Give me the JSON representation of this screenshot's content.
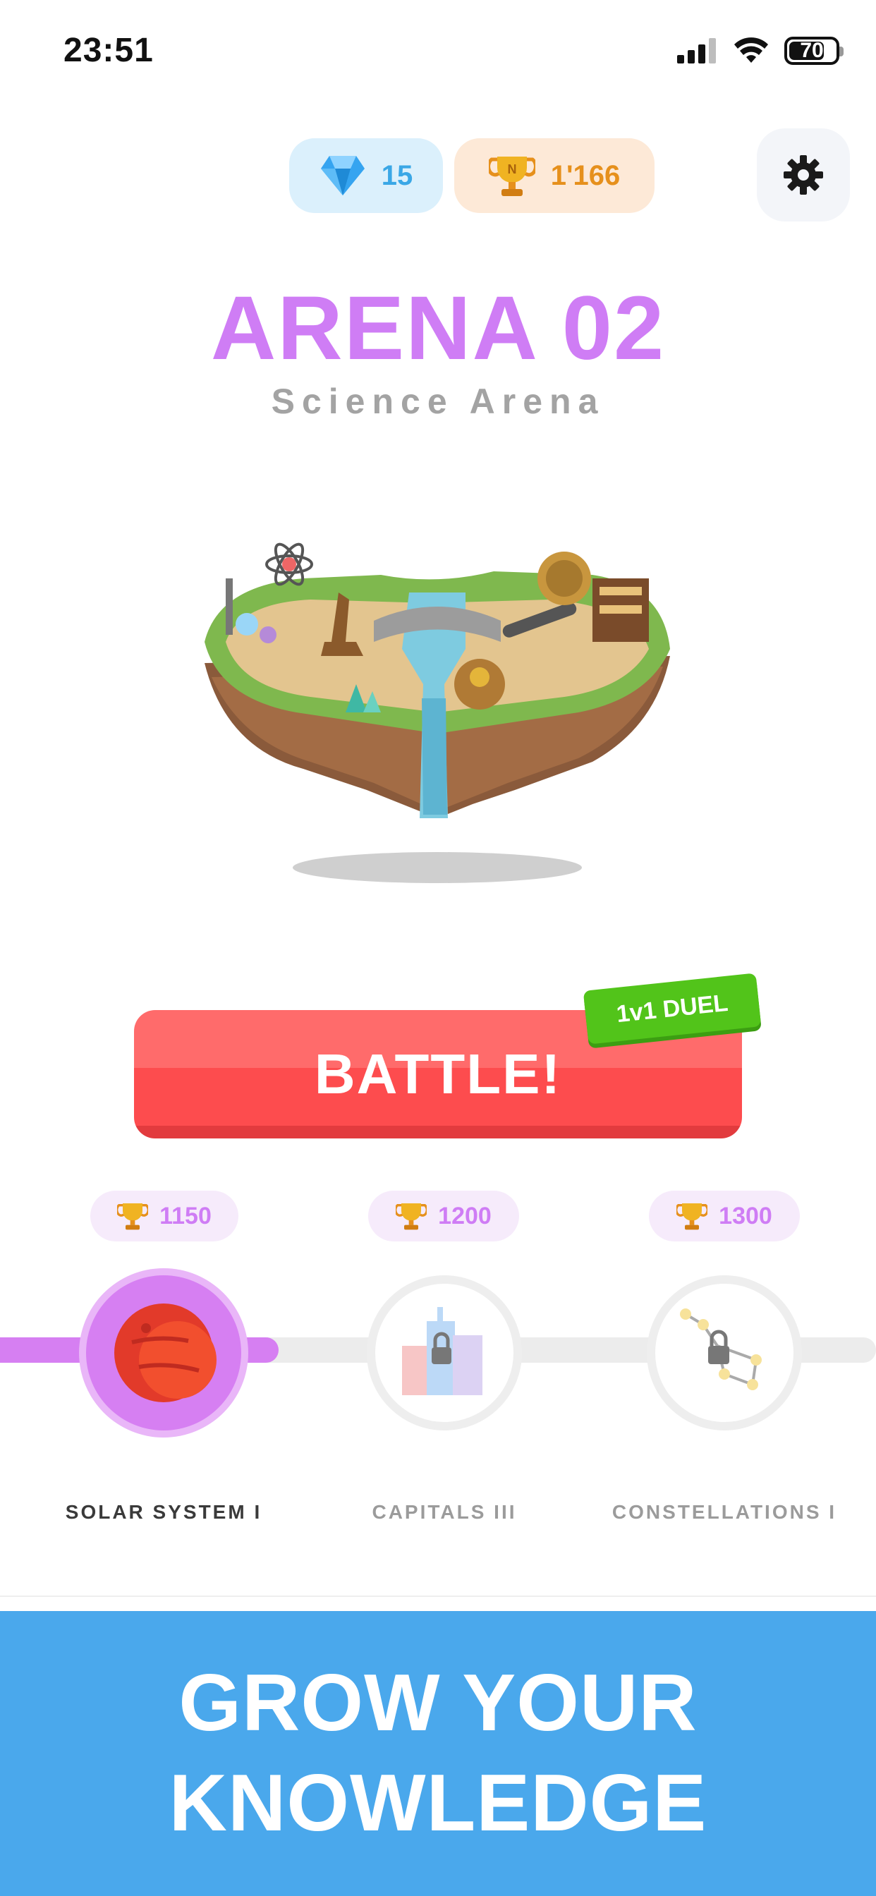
{
  "status_bar": {
    "time": "23:51",
    "battery": "70",
    "battery_level": 0.7,
    "icons": [
      "signal-icon",
      "wifi-icon",
      "battery-icon"
    ]
  },
  "currency": {
    "gems": "15",
    "trophies": "1'166",
    "gem_icon": "diamond-icon",
    "trophy_icon": "trophy-icon",
    "gem_color": "#3aa7e6",
    "trophy_color": "#e6901c"
  },
  "settings": {
    "icon": "gear-icon"
  },
  "arena": {
    "title": "ARENA 02",
    "subtitle": "Science Arena",
    "title_color": "#cf7df5"
  },
  "battle": {
    "label": "BATTLE!",
    "badge": "1v1 DUEL",
    "color": "#fd4c4e",
    "badge_color": "#52c41a"
  },
  "progression": {
    "progress_fraction": 0.32,
    "levels": [
      {
        "trophies": "1150",
        "label": "SOLAR SYSTEM I",
        "state": "active",
        "icon": "planet-icon"
      },
      {
        "trophies": "1200",
        "label": "CAPITALS III",
        "state": "locked",
        "icon": "city-lock-icon"
      },
      {
        "trophies": "1300",
        "label": "CONSTELLATIONS I",
        "state": "locked",
        "icon": "constellation-lock-icon"
      }
    ]
  },
  "promo": {
    "line1": "GROW YOUR",
    "line2": "KNOWLEDGE",
    "background": "#4aa8ec"
  }
}
